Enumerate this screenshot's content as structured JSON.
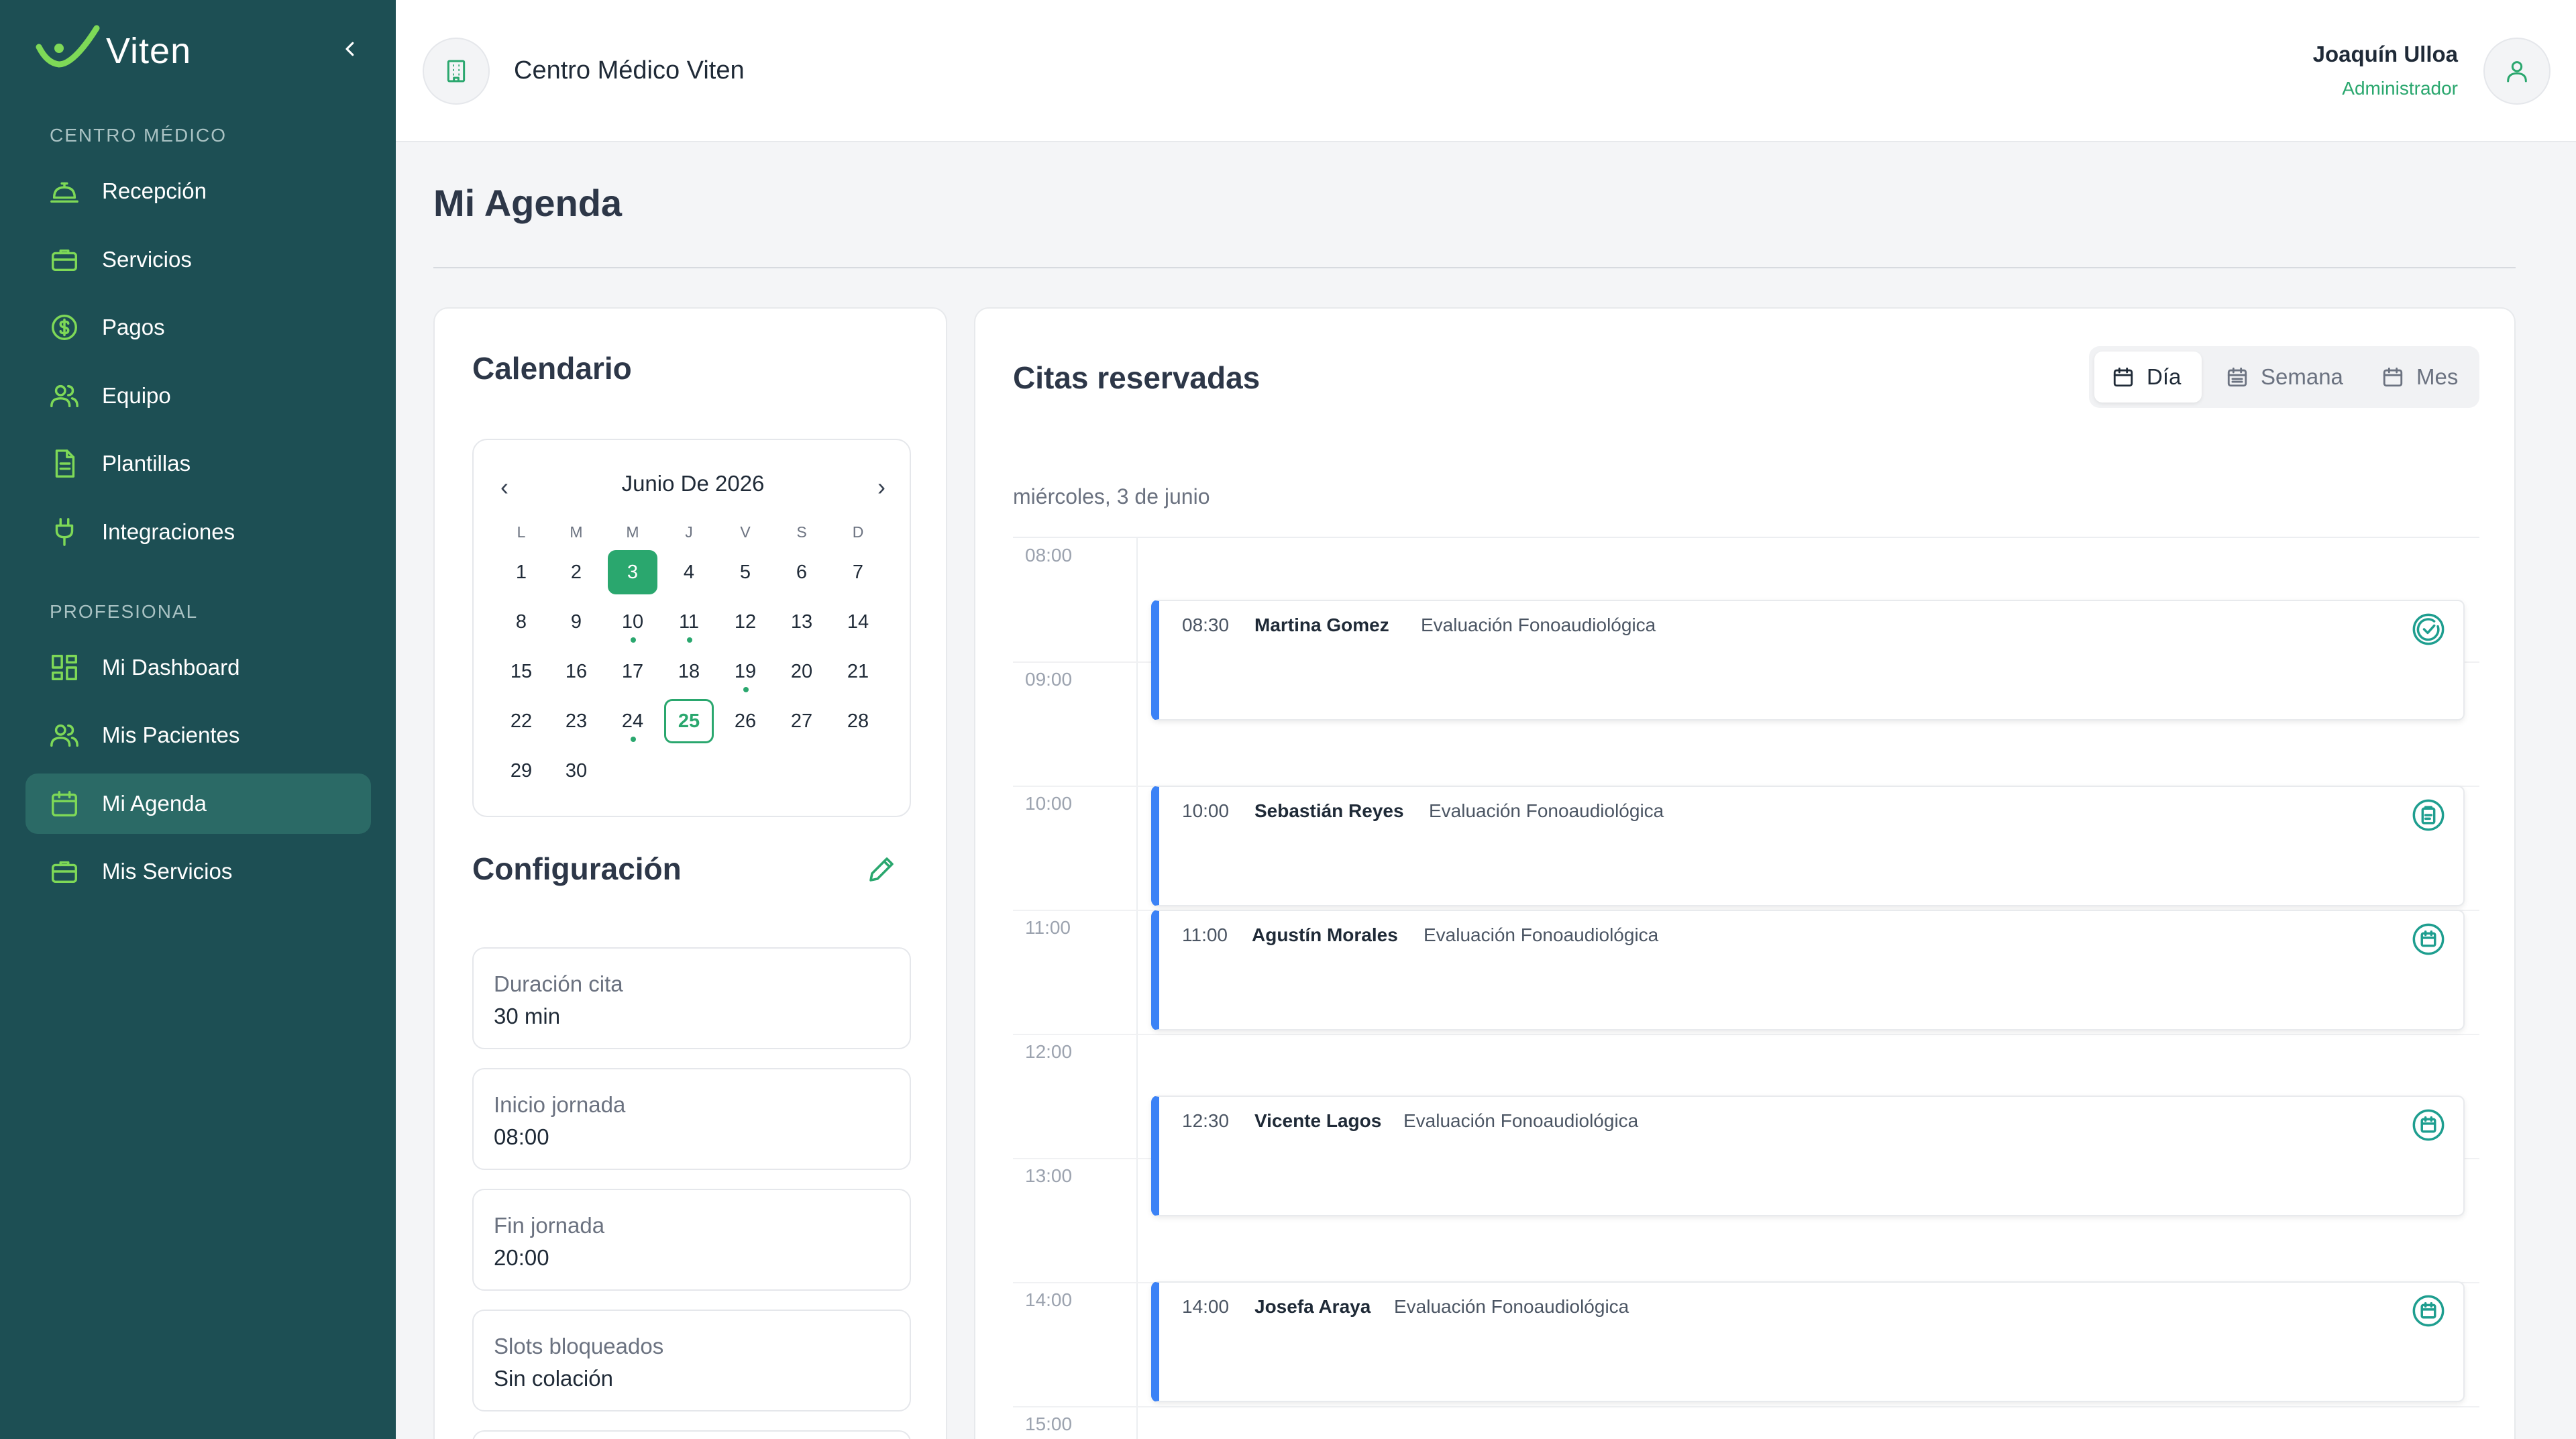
{
  "sidebar": {
    "brand": "Viten",
    "sections": [
      {
        "label": "CENTRO MÉDICO",
        "items": [
          {
            "label": "Recepción",
            "icon": "reception-bell-icon"
          },
          {
            "label": "Servicios",
            "icon": "briefcase-icon"
          },
          {
            "label": "Pagos",
            "icon": "dollar-circle-icon"
          },
          {
            "label": "Equipo",
            "icon": "users-icon"
          },
          {
            "label": "Plantillas",
            "icon": "document-icon"
          },
          {
            "label": "Integraciones",
            "icon": "plug-icon"
          }
        ]
      },
      {
        "label": "PROFESIONAL",
        "items": [
          {
            "label": "Mi Dashboard",
            "icon": "dashboard-grid-icon"
          },
          {
            "label": "Mis Pacientes",
            "icon": "users-icon"
          },
          {
            "label": "Mi Agenda",
            "icon": "calendar-icon",
            "active": true
          },
          {
            "label": "Mis Servicios",
            "icon": "briefcase-icon"
          }
        ]
      }
    ]
  },
  "header": {
    "org_name": "Centro Médico Viten",
    "user_name": "Joaquín Ulloa",
    "user_role": "Administrador"
  },
  "page": {
    "title": "Mi Agenda"
  },
  "calendar": {
    "title": "Calendario",
    "month_label": "Junio De 2026",
    "prev": "‹",
    "next": "›",
    "weekdays": [
      "L",
      "M",
      "M",
      "J",
      "V",
      "S",
      "D"
    ],
    "days": [
      [
        "1",
        "2",
        "3",
        "4",
        "5",
        "6",
        "7"
      ],
      [
        "8",
        "9",
        "10",
        "11",
        "12",
        "13",
        "14"
      ],
      [
        "15",
        "16",
        "17",
        "18",
        "19",
        "20",
        "21"
      ],
      [
        "22",
        "23",
        "24",
        "25",
        "26",
        "27",
        "28"
      ],
      [
        "29",
        "30"
      ]
    ],
    "selected_day": "3",
    "today_day": "25",
    "days_with_appointments": [
      "10",
      "11",
      "19",
      "24"
    ]
  },
  "configuracion": {
    "title": "Configuración",
    "items": [
      {
        "label": "Duración cita",
        "value": "30 min"
      },
      {
        "label": "Inicio jornada",
        "value": "08:00"
      },
      {
        "label": "Fin jornada",
        "value": "20:00"
      },
      {
        "label": "Slots bloqueados",
        "value": "Sin colación"
      }
    ]
  },
  "citas": {
    "title": "Citas reservadas",
    "views": [
      {
        "label": "Día",
        "active": true
      },
      {
        "label": "Semana",
        "active": false
      },
      {
        "label": "Mes",
        "active": false
      }
    ],
    "date_label": "miércoles, 3 de junio",
    "hours": [
      "08:00",
      "09:00",
      "10:00",
      "11:00",
      "12:00",
      "13:00",
      "14:00",
      "15:00"
    ],
    "appointments": [
      {
        "time": "08:30",
        "patient": "Martina Gomez",
        "service": "Evaluación Fonoaudiológica",
        "status": "completed"
      },
      {
        "time": "10:00",
        "patient": "Sebastián Reyes",
        "service": "Evaluación Fonoaudiológica",
        "status": "in-progress"
      },
      {
        "time": "11:00",
        "patient": "Agustín Morales",
        "service": "Evaluación Fonoaudiológica",
        "status": "scheduled"
      },
      {
        "time": "12:30",
        "patient": "Vicente Lagos",
        "service": "Evaluación Fonoaudiológica",
        "status": "scheduled"
      },
      {
        "time": "14:00",
        "patient": "Josefa Araya",
        "service": "Evaluación Fonoaudiológica",
        "status": "scheduled"
      }
    ]
  },
  "colors": {
    "sidebar_bg": "#1d4f54",
    "accent_green": "#2aa76e",
    "appointment_bar": "#3b82f6",
    "status_teal": "#1e9e8f"
  }
}
